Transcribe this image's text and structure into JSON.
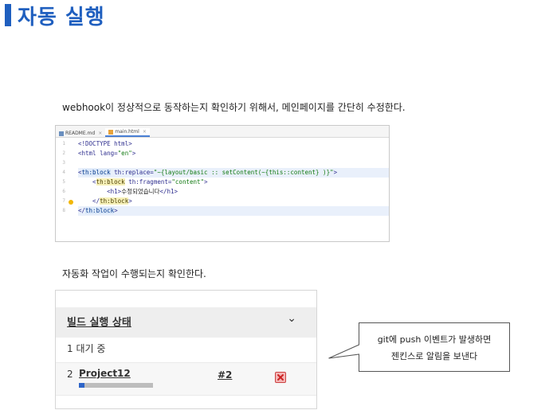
{
  "page": {
    "title": "자동 실행"
  },
  "text": {
    "p1": "webhook이 정상적으로 동작하는지 확인하기 위해서, 메인페이지를 간단히 수정한다.",
    "p2": "자동화 작업이 수행되는지 확인한다."
  },
  "editor": {
    "tabs": [
      {
        "label": "README.md",
        "icon": "markdown-file-icon"
      },
      {
        "label": "main.html",
        "icon": "html-file-icon",
        "active": true
      }
    ],
    "line_numbers": [
      "1",
      "2",
      "3",
      "4",
      "5",
      "6",
      "7",
      "8"
    ],
    "lines": [
      {
        "parts": [
          {
            "t": "<!DOCTYPE ",
            "c": "tag"
          },
          {
            "t": "html",
            "c": "tag"
          },
          {
            "t": ">",
            "c": "tag"
          }
        ]
      },
      {
        "parts": [
          {
            "t": "<html ",
            "c": "tag"
          },
          {
            "t": "lang=",
            "c": "attr"
          },
          {
            "t": "\"en\"",
            "c": "val"
          },
          {
            "t": ">",
            "c": "tag"
          }
        ]
      },
      {
        "parts": []
      },
      {
        "parts": [
          {
            "t": "<",
            "c": "tag"
          },
          {
            "t": "th:block",
            "c": "thblock"
          },
          {
            "t": " th:replace=",
            "c": "attr"
          },
          {
            "t": "\"~{layout/basic :: setContent(~{this::content} )}\"",
            "c": "val"
          },
          {
            "t": ">",
            "c": "tag"
          }
        ]
      },
      {
        "parts": [
          {
            "t": "    <",
            "c": "tag"
          },
          {
            "t": "th:block",
            "c": "thyellow"
          },
          {
            "t": " th:fragment=",
            "c": "attr"
          },
          {
            "t": "\"content\"",
            "c": "val"
          },
          {
            "t": ">",
            "c": "tag"
          }
        ]
      },
      {
        "parts": [
          {
            "t": "        <h1>",
            "c": "tag"
          },
          {
            "t": "수정되었습니다",
            "c": "plain"
          },
          {
            "t": "</h1>",
            "c": "tag"
          }
        ]
      },
      {
        "parts": [
          {
            "t": "    </",
            "c": "tag"
          },
          {
            "t": "th:block",
            "c": "thyellow"
          },
          {
            "t": ">",
            "c": "tag"
          }
        ]
      },
      {
        "parts": [
          {
            "t": "</",
            "c": "tag"
          },
          {
            "t": "th:block",
            "c": "thblock"
          },
          {
            "t": ">",
            "c": "tag"
          }
        ]
      }
    ]
  },
  "build_panel": {
    "title": "빌드 실행 상태",
    "queue_row": "1  대기 중",
    "executor_num": "2",
    "project": "Project12",
    "progress_fraction": 0.08,
    "build_number": "#2"
  },
  "callout": {
    "line1": "git에 push 이벤트가 발생하면",
    "line2": "젠킨스로 알림을 보낸다"
  },
  "colors": {
    "accent": "#1f5fbf",
    "progress": "#2d64c8"
  }
}
